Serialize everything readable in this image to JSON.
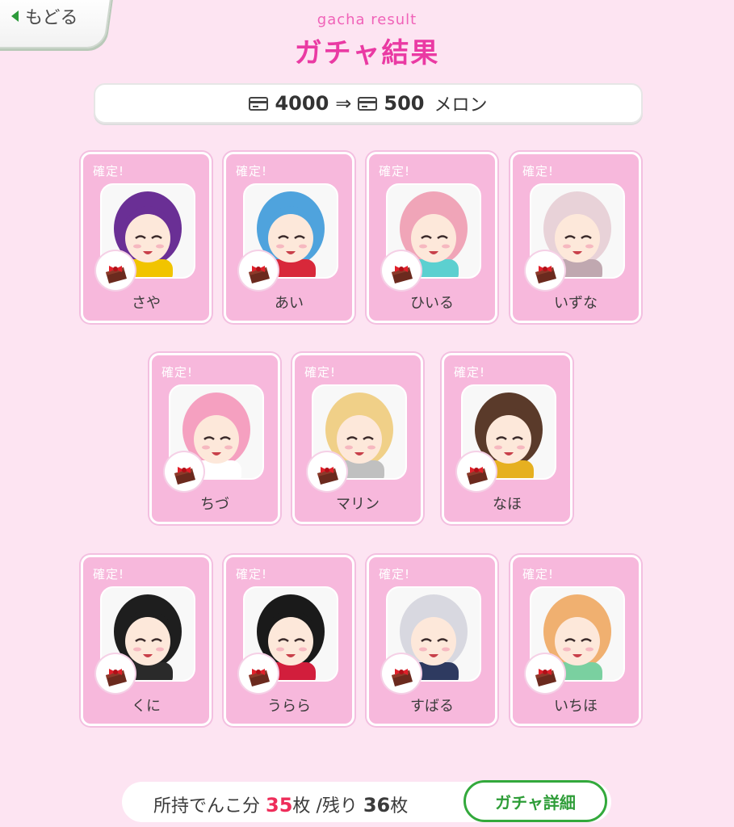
{
  "nav": {
    "back_label": "もどる"
  },
  "header": {
    "subtitle": "gacha result",
    "title": "ガチャ結果"
  },
  "cost": {
    "before": "4000",
    "arrow": "⇒",
    "after": "500",
    "unit": "メロン"
  },
  "cards": [
    {
      "badge": "確定!",
      "name": "さや",
      "hair": "#6a2f95",
      "accent": "#f1c400"
    },
    {
      "badge": "確定!",
      "name": "あい",
      "hair": "#4fa3dd",
      "accent": "#d8283a"
    },
    {
      "badge": "確定!",
      "name": "ひいる",
      "hair": "#f0a5b8",
      "accent": "#5cd0d0"
    },
    {
      "badge": "確定!",
      "name": "いずな",
      "hair": "#e8d2d8",
      "accent": "#c0a8b0"
    },
    {
      "badge": "確定!",
      "name": "ちづ",
      "hair": "#f5a0c0",
      "accent": "#ffffff"
    },
    {
      "badge": "確定!",
      "name": "マリン",
      "hair": "#f0d088",
      "accent": "#c0c0c0"
    },
    {
      "badge": "確定!",
      "name": "なほ",
      "hair": "#5a3a2a",
      "accent": "#e6b020"
    },
    {
      "badge": "確定!",
      "name": "くに",
      "hair": "#1e1e1e",
      "accent": "#2a2a2a"
    },
    {
      "badge": "確定!",
      "name": "うらら",
      "hair": "#1a1a1a",
      "accent": "#d21e3c"
    },
    {
      "badge": "確定!",
      "name": "すばる",
      "hair": "#d8d8e0",
      "accent": "#2e3a60"
    },
    {
      "badge": "確定!",
      "name": "いちほ",
      "hair": "#f0b070",
      "accent": "#7ad0a0"
    }
  ],
  "footer": {
    "stock_prefix": "所持でんこ分",
    "owned": "35",
    "owned_unit": "枚",
    "remain_prefix": "/残り",
    "remaining": "36",
    "remain_unit": "枚",
    "detail_button": "ガチャ詳細"
  }
}
